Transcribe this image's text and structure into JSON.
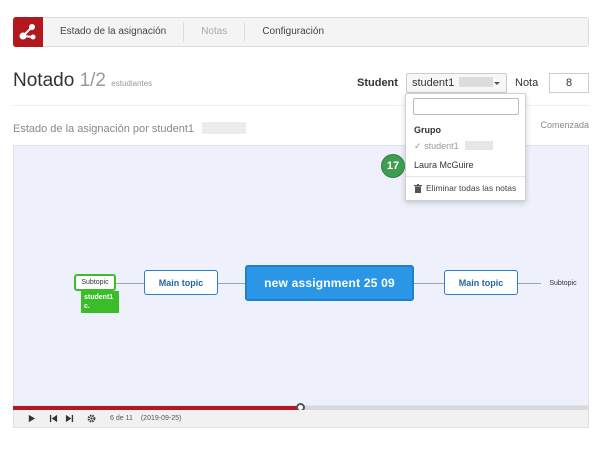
{
  "nav": {
    "tabs": [
      {
        "label": "Estado de la asignación"
      },
      {
        "label": "Notas"
      },
      {
        "label": "Configuración"
      }
    ]
  },
  "header": {
    "title": "Notado",
    "count": "1/2",
    "count_unit": "estudiantes",
    "student_label": "Student",
    "student_selected": "student1",
    "nota_label": "Nota",
    "nota_value": "8"
  },
  "subheader": {
    "label": "Estado de la asignación por student1",
    "status": "Comenzada"
  },
  "mindmap": {
    "center": "new assignment 25 09",
    "main_left": "Main topic",
    "main_right": "Main topic",
    "sub_left": "Subtopic",
    "sub_right": "Subtopic",
    "note_line1": "student1",
    "note_line2": "c."
  },
  "player": {
    "position": "6 de 11",
    "date": "(2019-09-25)",
    "progress_fraction": 0.5
  },
  "dropdown": {
    "group_label": "Grupo",
    "item_selected": "student1",
    "item_other": "Laura McGuire",
    "action": "Eliminar todas las notas"
  },
  "badge": {
    "value": "17"
  },
  "colors": {
    "brand": "#b3181f",
    "center_node": "#2b96e6",
    "note_green": "#3bbd2a",
    "badge": "#3f9d52"
  }
}
